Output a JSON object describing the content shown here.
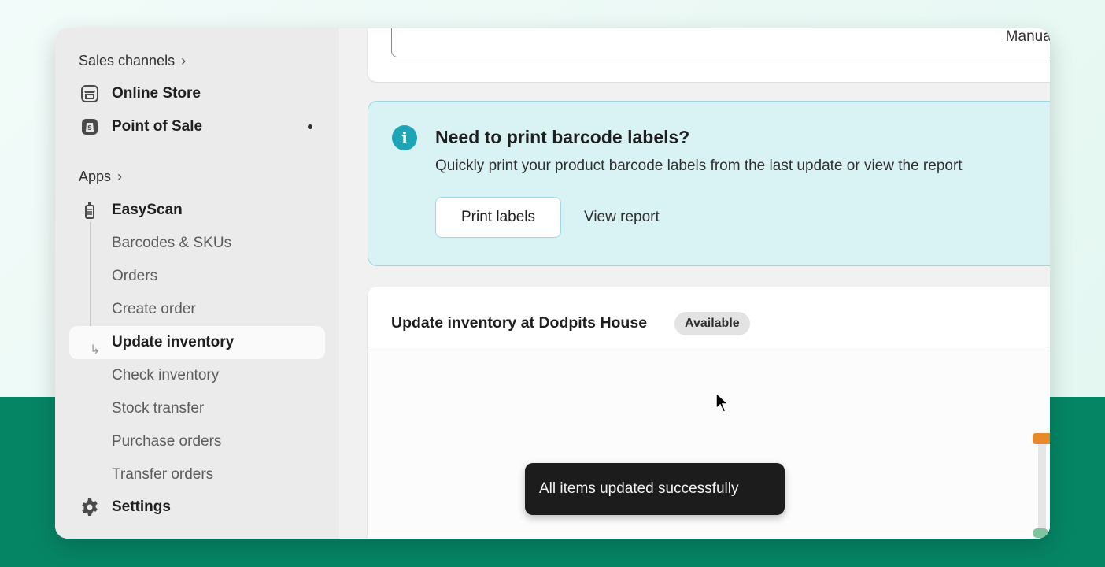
{
  "sidebar": {
    "sales_channels_label": "Sales channels",
    "apps_label": "Apps",
    "channels": [
      {
        "label": "Online Store",
        "icon": "store-icon"
      },
      {
        "label": "Point of Sale",
        "icon": "pos-bag-icon",
        "has_dot": true
      }
    ],
    "app_name": "EasyScan",
    "app_items": [
      "Barcodes & SKUs",
      "Orders",
      "Create order",
      "Update inventory",
      "Check inventory",
      "Stock transfer",
      "Purchase orders",
      "Transfer orders"
    ],
    "active_item": "Update inventory",
    "settings_label": "Settings"
  },
  "main": {
    "top_select_value": "Manual",
    "banner": {
      "title": "Need to print barcode labels?",
      "text": "Quickly print your product barcode labels from the last update or view the report",
      "print_button": "Print labels",
      "report_link": "View report"
    },
    "inventory_card": {
      "title": "Update inventory at Dodpits House",
      "badge": "Available"
    }
  },
  "toast": {
    "message": "All items updated successfully"
  },
  "colors": {
    "accent_teal": "#1ea5b5",
    "banner_bg": "#d9f3f5",
    "page_green": "#068565"
  }
}
